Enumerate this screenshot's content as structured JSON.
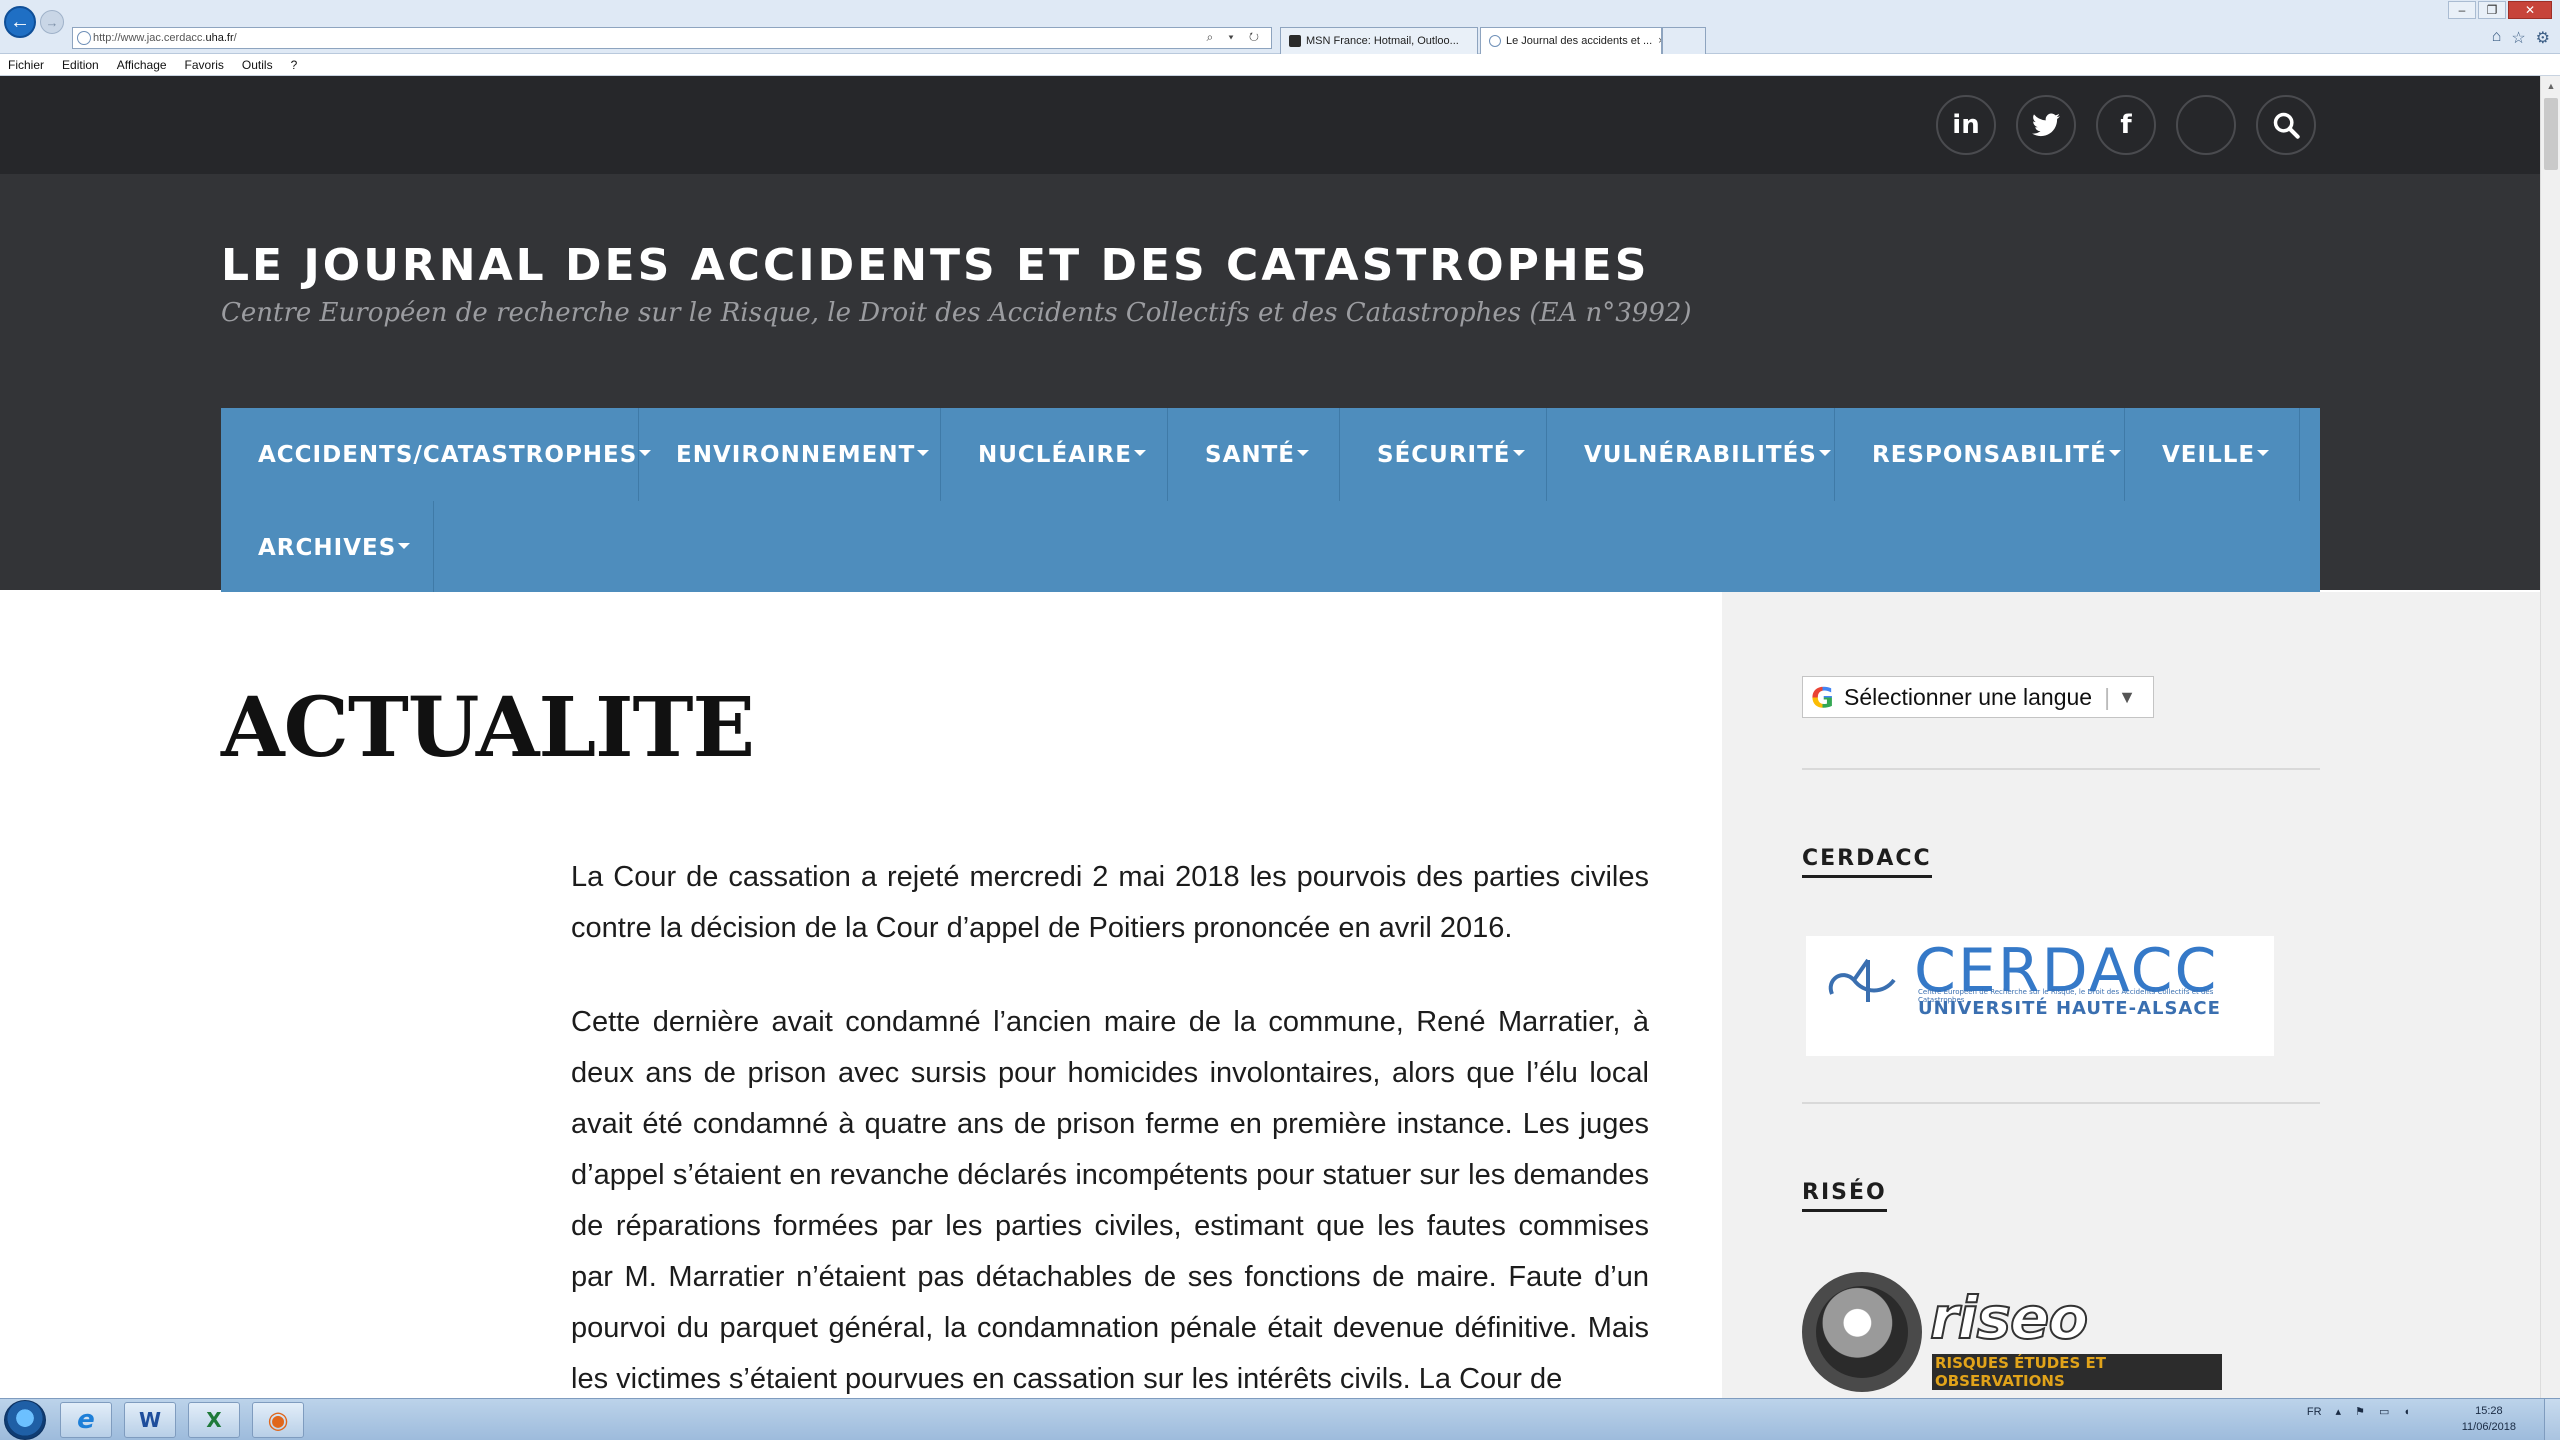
{
  "browser": {
    "url_prefix": "http://www.jac.cerdacc.",
    "url_host": "uha.fr",
    "url_suffix": "/",
    "tabs": [
      {
        "title": "MSN France: Hotmail, Outloo...",
        "active": false
      },
      {
        "title": "Le Journal des accidents et ...",
        "active": true
      }
    ],
    "tab_close": "×",
    "menu": [
      "Fichier",
      "Edition",
      "Affichage",
      "Favoris",
      "Outils",
      "?"
    ],
    "address_tools": "⌕ ▾ ↻",
    "window_controls": [
      "–",
      "❐",
      "✕"
    ],
    "toolbar_icons": [
      "home-icon",
      "star-icon",
      "gear-icon"
    ]
  },
  "social": {
    "buttons": [
      {
        "name": "linkedin",
        "glyph": "in"
      },
      {
        "name": "twitter",
        "glyph": "🐦"
      },
      {
        "name": "facebook",
        "glyph": "f"
      },
      {
        "name": "blank",
        "glyph": ""
      },
      {
        "name": "search",
        "glyph": "⚲"
      }
    ]
  },
  "site": {
    "title": "LE JOURNAL DES ACCIDENTS ET DES CATASTROPHES",
    "tagline": "Centre Européen de recherche sur le Risque, le Droit des Accidents Collectifs et des Catastrophes (EA n°3992)"
  },
  "nav": {
    "items": [
      "ACCIDENTS/CATASTROPHES",
      "ENVIRONNEMENT",
      "NUCLÉAIRE",
      "SANTÉ",
      "SÉCURITÉ",
      "VULNÉRABILITÉS",
      "RESPONSABILITÉ",
      "VEILLE",
      "ARCHIVES"
    ]
  },
  "article": {
    "title": "ACTUALITE",
    "paragraphs": [
      "La Cour de cassation a rejeté mercredi 2 mai 2018 les pourvois des parties civiles contre la décision de la Cour d’appel de Poitiers prononcée en avril 2016.",
      "Cette dernière avait condamné l’ancien maire de la commune, René Marratier, à deux ans de prison avec sursis pour homicides involontaires, alors que l’élu local avait été condamné à quatre ans de prison ferme en première instance. Les juges d’appel s’étaient en revanche déclarés incompétents pour statuer sur les demandes de réparations formées par les parties civiles, estimant que les fautes commises par M. Marratier n’étaient pas détachables de ses fonctions de maire. Faute d’un pourvoi du parquet général, la condamnation pénale était devenue définitive. Mais les victimes s’étaient pourvues en cassation sur les intérêts civils. La Cour de"
    ]
  },
  "sidebar": {
    "language_select": {
      "label": "Sélectionner une langue",
      "arrow": "▼",
      "logo": "G"
    },
    "widgets": [
      {
        "title": "CERDACC"
      },
      {
        "title": "RISÉO"
      }
    ],
    "cerdacc_logo": {
      "wordmark": "CERDACC",
      "subtitle": "Centre Européen de Recherche sur le Risque, le Droit des Accidents Collectifs et des Catastrophes",
      "university": "UNIVERSITÉ HAUTE-ALSACE"
    },
    "riseo_logo": {
      "wordmark": "riseo",
      "subtitle": "RISQUES ÉTUDES ET OBSERVATIONS"
    }
  },
  "taskbar": {
    "apps": [
      {
        "name": "internet-explorer",
        "glyph": "e",
        "color": "#1e7fd8"
      },
      {
        "name": "word",
        "glyph": "W",
        "color": "#1f4e9c"
      },
      {
        "name": "excel",
        "glyph": "X",
        "color": "#1f7a3a"
      },
      {
        "name": "firefox",
        "glyph": "◉",
        "color": "#e0661b"
      }
    ],
    "lang": "FR",
    "time": "15:28",
    "date": "11/06/2018"
  }
}
